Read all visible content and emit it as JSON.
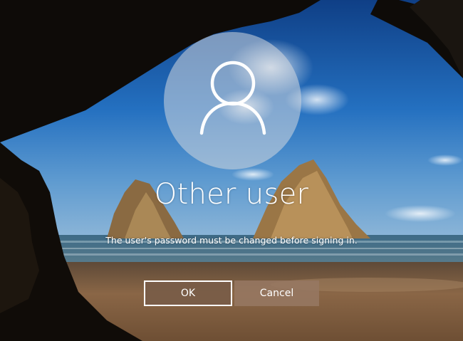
{
  "login": {
    "user_name": "Other user",
    "message": "The user's password must be changed before signing in."
  },
  "buttons": {
    "ok_label": "OK",
    "cancel_label": "Cancel"
  },
  "icons": {
    "avatar": "user-silhouette-icon"
  },
  "colors": {
    "sky": "#1d5fae",
    "sea": "#2f5a6e",
    "sand": "#7a5a3e",
    "button_primary": "#785c48",
    "button_secondary": "#96785f",
    "text": "#ffffff"
  }
}
